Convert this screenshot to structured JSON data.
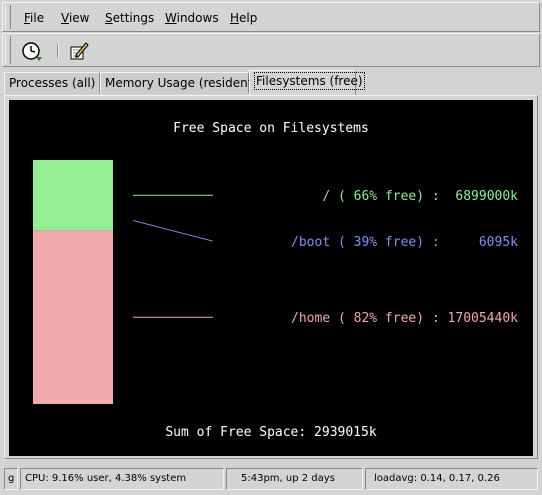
{
  "menu": {
    "file": {
      "u": "F",
      "rest": "ile"
    },
    "view": {
      "u": "V",
      "rest": "iew"
    },
    "settings": {
      "u": "S",
      "rest": "ettings"
    },
    "windows": {
      "u": "W",
      "rest": "indows"
    },
    "help": {
      "u": "H",
      "rest": "elp"
    }
  },
  "toolbar": {
    "buttons": [
      {
        "icon": "refresh-clock-icon"
      },
      {
        "icon": "edit-pencil-icon"
      }
    ]
  },
  "tabs": [
    {
      "label": "Processes (all)",
      "active": false
    },
    {
      "label": "Memory Usage (resident)",
      "active": false
    },
    {
      "label": "Filesystems (free)",
      "active": true
    }
  ],
  "chart_data": {
    "type": "bar",
    "title": "Free Space on Filesystems",
    "series": [
      {
        "name": "/",
        "percent_free": 66,
        "free_kb": 6899000,
        "label": "/ ( 66% free) :  6899000k",
        "color": "#90ee90"
      },
      {
        "name": "/boot",
        "percent_free": 39,
        "free_kb": 6095,
        "label": "/boot ( 39% free) :     6095k",
        "color": "#8090f0"
      },
      {
        "name": "/home",
        "percent_free": 82,
        "free_kb": 17005440,
        "label": "/home ( 82% free) : 17005440k",
        "color": "#f0a8a8"
      }
    ],
    "sum_label": "Sum of Free Space: 2939015k",
    "background": "#000000"
  },
  "status": {
    "indicator": "g",
    "cpu": "CPU:  9.16% user,  4.38% system",
    "uptime": "5:43pm, up 2 days",
    "loadavg": "loadavg: 0.14, 0.17, 0.26"
  }
}
